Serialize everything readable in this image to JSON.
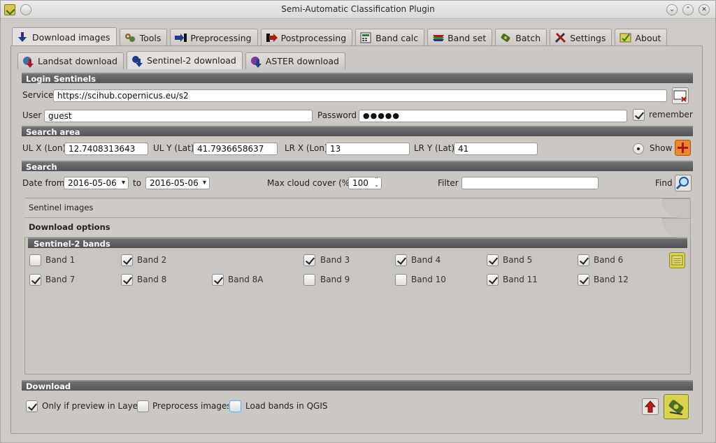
{
  "window": {
    "title": "Semi-Automatic Classification Plugin"
  },
  "main_tabs": [
    {
      "label": "Download images",
      "icon": "download-arrow-icon"
    },
    {
      "label": "Tools",
      "icon": "tools-icon"
    },
    {
      "label": "Preprocessing",
      "icon": "preprocessing-icon"
    },
    {
      "label": "Postprocessing",
      "icon": "postprocessing-icon"
    },
    {
      "label": "Band calc",
      "icon": "band-calc-icon"
    },
    {
      "label": "Band set",
      "icon": "band-set-icon"
    },
    {
      "label": "Batch",
      "icon": "batch-icon"
    },
    {
      "label": "Settings",
      "icon": "settings-icon"
    },
    {
      "label": "About",
      "icon": "about-icon"
    }
  ],
  "sub_tabs": [
    {
      "label": "Landsat download"
    },
    {
      "label": "Sentinel-2 download"
    },
    {
      "label": "ASTER download"
    }
  ],
  "login": {
    "section": "Login Sentinels",
    "service_label": "Service",
    "service_value": "https://scihub.copernicus.eu/s2",
    "user_label": "User",
    "user_value": "guest",
    "password_label": "Password",
    "password_value": "●●●●●",
    "remember_label": "remember",
    "remember_checked": true
  },
  "search_area": {
    "section": "Search area",
    "ulx_label": "UL X (Lon)",
    "ulx_value": "12.7408313643",
    "uly_label": "UL Y (Lat)",
    "uly_value": "41.7936658637",
    "lrx_label": "LR X (Lon)",
    "lrx_value": "13",
    "lry_label": "LR Y (Lat)",
    "lry_value": "41",
    "show_label": "Show"
  },
  "search": {
    "section": "Search",
    "date_from_label": "Date from",
    "date_from_value": "2016-05-06",
    "to_label": "to",
    "date_to_value": "2016-05-06",
    "cloud_label": "Max cloud cover (%)",
    "cloud_value": "100",
    "filter_label": "Filter",
    "filter_value": "",
    "find_label": "Find"
  },
  "toolbox": {
    "sentinel_images": "Sentinel images",
    "download_options": "Download options",
    "bands_section": "Sentinel-2 bands",
    "bands": [
      {
        "label": "Band 1",
        "checked": false
      },
      {
        "label": "Band 2",
        "checked": true
      },
      {
        "label": "Band 3",
        "checked": true
      },
      {
        "label": "Band 4",
        "checked": true
      },
      {
        "label": "Band 5",
        "checked": true
      },
      {
        "label": "Band 6",
        "checked": true
      },
      {
        "label": "Band 7",
        "checked": true
      },
      {
        "label": "Band 8",
        "checked": true
      },
      {
        "label": "Band 8A",
        "checked": true
      },
      {
        "label": "Band 9",
        "checked": false
      },
      {
        "label": "Band 10",
        "checked": false
      },
      {
        "label": "Band 11",
        "checked": true
      },
      {
        "label": "Band 12",
        "checked": true
      }
    ]
  },
  "download": {
    "section": "Download",
    "only_preview_label": "Only if preview in Layers",
    "only_preview_checked": true,
    "preprocess_label": "Preprocess images",
    "preprocess_checked": false,
    "load_bands_label": "Load bands in QGIS",
    "load_bands_checked": false
  },
  "colors": {
    "section_bar": "#5e5e5e",
    "panel_bg": "#cbc7c3",
    "accent_orange": "#e8872b",
    "accent_yellow": "#d9d34a"
  }
}
